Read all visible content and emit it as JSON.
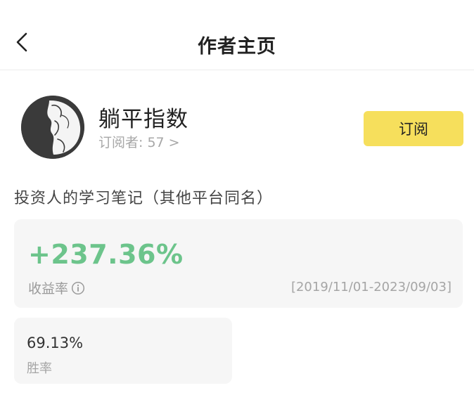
{
  "header": {
    "title": "作者主页"
  },
  "author": {
    "name": "躺平指数",
    "subscribers_label": "订阅者: 57",
    "subscribers_chevron": ">",
    "subscribe_button": "订阅",
    "bio": "投资人的学习笔记（其他平台同名）"
  },
  "performance": {
    "return_value": "+237.36%",
    "return_label": "收益率",
    "date_range": "[2019/11/01-2023/09/03]",
    "win_rate_value": "69.13%",
    "win_rate_label": "胜率"
  },
  "colors": {
    "accent_button": "#f6df5c",
    "return_positive": "#6cc48b"
  },
  "icons": {
    "back": "chevron-left-icon",
    "info": "info-icon"
  }
}
